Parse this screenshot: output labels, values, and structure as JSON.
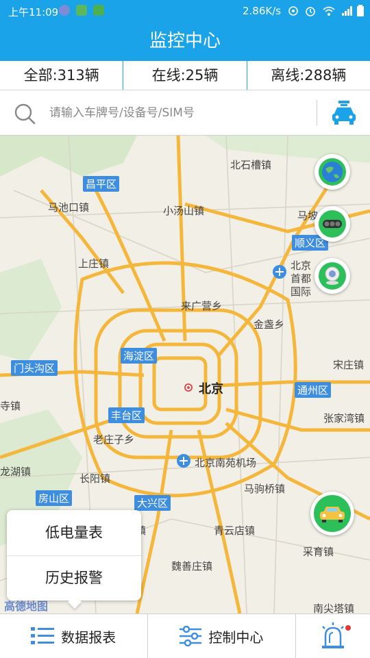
{
  "status_bar": {
    "time": "上午11:09",
    "speed": "2.86K/s"
  },
  "header": {
    "title": "监控中心"
  },
  "stats": {
    "all": "全部:313辆",
    "online": "在线:25辆",
    "offline": "离线:288辆"
  },
  "search": {
    "placeholder": "请输入车牌号/设备号/SIM号"
  },
  "map": {
    "districts": [
      "昌平区",
      "顺义区",
      "门头沟区",
      "海淀区",
      "通州区",
      "丰台区",
      "房山区",
      "大兴区"
    ],
    "center_city": "北京",
    "places": [
      "北石槽镇",
      "马池口镇",
      "小汤山镇",
      "马坡",
      "上庄镇",
      "北京首都国际",
      "来广营乡",
      "金盏乡",
      "宋庄镇",
      "寺镇",
      "张家湾镇",
      "老庄子乡",
      "龙湖镇",
      "长阳镇",
      "北京南苑机场",
      "马驹桥镇",
      "瀛海镇",
      "青云店镇",
      "采育镇",
      "魏善庄镇",
      "南尖塔镇",
      "高德地图"
    ]
  },
  "popup_menu": {
    "low_battery": "低电量表",
    "history_alarm": "历史报警"
  },
  "bottom_nav": {
    "data_report": "数据报表",
    "control_center": "控制中心"
  },
  "colors": {
    "primary": "#1aa3e8",
    "road_major": "#f5b73b",
    "district_label": "#3d8ee0"
  }
}
